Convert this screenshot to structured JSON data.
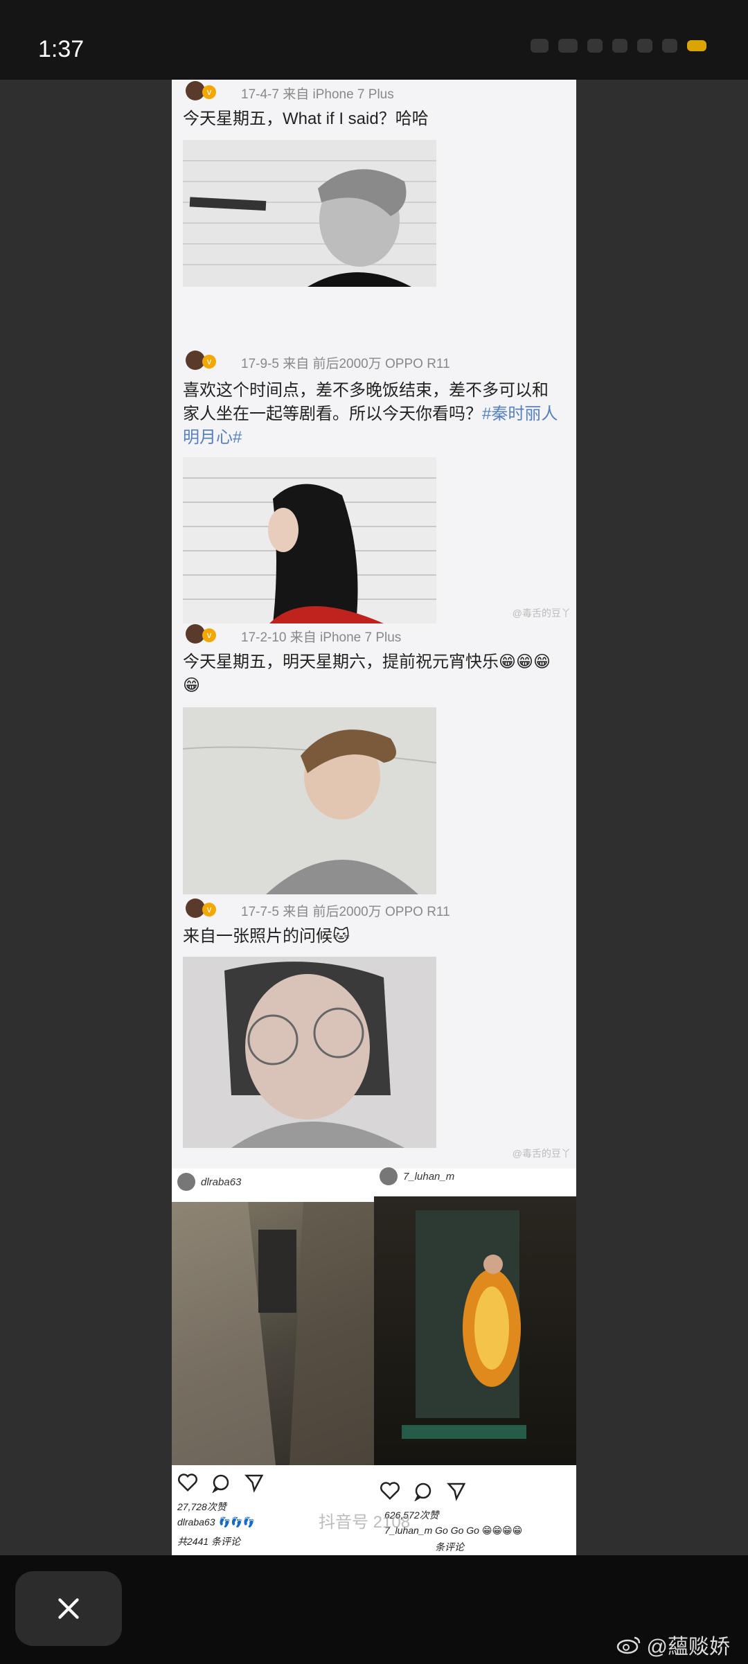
{
  "status_bar": {
    "time": "1:37"
  },
  "posts": [
    {
      "meta": "17-4-7  来自 iPhone 7 Plus",
      "text": "今天星期五，What if I said？哈哈",
      "tag": ""
    },
    {
      "meta": "17-9-5  来自 前后2000万 OPPO R11",
      "text": "喜欢这个时间点，差不多晚饭结束，差不多可以和家人坐在一起等剧看。所以今天你看吗？",
      "tag": "#秦时丽人明月心#",
      "watermark": "@毒舌的豆丫"
    },
    {
      "meta": "17-2-10  来自 iPhone 7 Plus",
      "text": "今天星期五，明天星期六，提前祝元宵快乐😁😁😁😁",
      "tag": ""
    },
    {
      "meta": "17-7-5  来自 前后2000万 OPPO R11",
      "text": "来自一张照片的问候🐱",
      "tag": "",
      "watermark": "@毒舌的豆丫"
    }
  ],
  "instagram": {
    "left": {
      "username": "dlraba63",
      "likes": "27,728次赞",
      "caption": "dlraba63 👣👣👣",
      "comments": "共2441 条评论"
    },
    "right": {
      "username": "7_luhan_m",
      "likes": "626,572次赞",
      "caption": "7_luhan_m Go Go Go 😁😁😁😁",
      "comments": "条评论"
    }
  },
  "overlay": {
    "tiktok": "抖音号 2108"
  },
  "bottom": {
    "close_label": "Close",
    "watermark": "@蘊赕娇"
  },
  "colors": {
    "tag_color": "#5680c0",
    "verified_badge": "#f2a800"
  }
}
